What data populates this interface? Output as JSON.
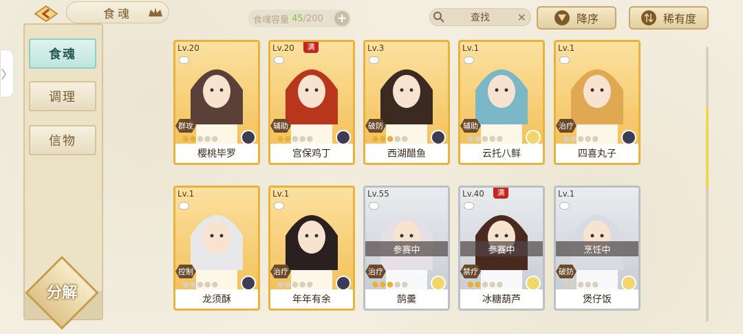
{
  "header": {
    "title": "食魂",
    "capacity_label": "食魂容量",
    "capacity_current": "45",
    "capacity_total": "/200",
    "capacity_add": "+",
    "search_text": "查找",
    "search_clear": "✕",
    "sort_desc_label": "降序",
    "sort_rarity_label": "稀有度"
  },
  "sidebar": {
    "items": [
      {
        "label": "食魂",
        "active": true
      },
      {
        "label": "调理",
        "active": false
      },
      {
        "label": "信物",
        "active": false
      }
    ],
    "decompose_label": "分解",
    "expand_glyph": "〉"
  },
  "cards": [
    {
      "level": "Lv.20",
      "role": "群攻",
      "stars_on": 2,
      "name": "樱桃毕罗",
      "frame": "gold",
      "element": "dark",
      "status": "",
      "full": false,
      "hair": "#5a4038"
    },
    {
      "level": "Lv.20",
      "role": "辅助",
      "stars_on": 2,
      "name": "宫保鸡丁",
      "frame": "gold",
      "element": "dark",
      "status": "",
      "full": true,
      "full_label": "满",
      "hair": "#b8361c"
    },
    {
      "level": "Lv.3",
      "role": "破防",
      "stars_on": 3,
      "name": "西湖醋鱼",
      "frame": "gold",
      "element": "dark",
      "status": "",
      "full": false,
      "hair": "#3a2a22"
    },
    {
      "level": "Lv.1",
      "role": "辅助",
      "stars_on": 0,
      "name": "云托八鲜",
      "frame": "gold",
      "element": "light",
      "status": "",
      "full": false,
      "hair": "#7ab8c8"
    },
    {
      "level": "Lv.1",
      "role": "治疗",
      "stars_on": 0,
      "name": "四喜丸子",
      "frame": "gold",
      "element": "dark",
      "status": "",
      "full": false,
      "hair": "#e0a850"
    },
    {
      "level": "Lv.1",
      "role": "控制",
      "stars_on": 0,
      "name": "龙须酥",
      "frame": "gold",
      "element": "dark",
      "status": "",
      "full": false,
      "hair": "#e8e8ea"
    },
    {
      "level": "Lv.1",
      "role": "治疗",
      "stars_on": 0,
      "name": "年年有余",
      "frame": "gold",
      "element": "dark",
      "status": "",
      "full": false,
      "hair": "#2a2020"
    },
    {
      "level": "Lv.55",
      "role": "治疗",
      "stars_on": 3,
      "name": "鹄羹",
      "frame": "silver",
      "element": "light",
      "status": "参赛中",
      "full": false,
      "hair": "#e6e0e6"
    },
    {
      "level": "Lv.40",
      "role": "禁疗",
      "stars_on": 2,
      "name": "冰糖葫芦",
      "frame": "silver",
      "element": "light",
      "status": "参赛中",
      "full": true,
      "full_label": "满",
      "hair": "#4a2a1e"
    },
    {
      "level": "Lv.1",
      "role": "破防",
      "stars_on": 0,
      "name": "煲仔饭",
      "frame": "silver",
      "element": "light",
      "status": "烹饪中",
      "full": false,
      "hair": "#d8dce2"
    }
  ],
  "colors": {
    "gold_frame": "#e9b23c",
    "silver_frame": "#b9c0c8",
    "active_tab": "#bde5dc",
    "capacity_current": "#7fbf4d"
  }
}
